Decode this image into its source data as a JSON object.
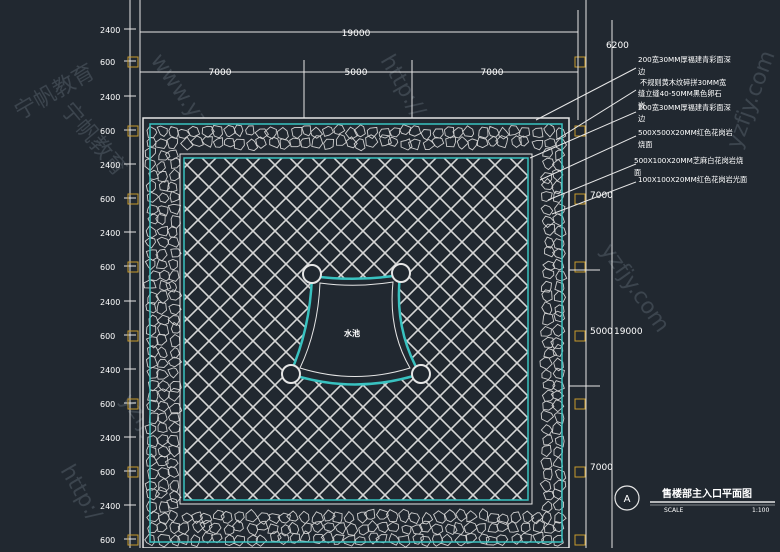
{
  "colors": {
    "background": "#212830",
    "linework": "#e6e6e6",
    "border_cyan": "#39c2c0",
    "dim_text": "#ffffff",
    "pillar": "#c89a2b",
    "watermark": "#6f7a86"
  },
  "left_dims": [
    "2400",
    "600",
    "2400",
    "600",
    "2400",
    "600",
    "2400",
    "600",
    "2400",
    "600",
    "2400",
    "600",
    "2400",
    "600",
    "2400",
    "600"
  ],
  "top_dims": {
    "overall": "19000",
    "left": "7000",
    "middle": "5000",
    "right": "7000"
  },
  "right_dims": {
    "top": "6200",
    "upper": "7000",
    "middle": "5000",
    "total": "19000",
    "lower": "7000"
  },
  "callouts": [
    "200宽30MM厚福建青彩面深",
    "边",
    "不规则黄木纹碎拼30MM宽",
    "缝立缝40-50MM黑色卵石",
    "嵌",
    "200宽30MM厚福建青彩面深",
    "边",
    "500X500X20MM红色花岗岩",
    "烧面",
    "500X100X20MM芝麻白花岗岩烧",
    "面",
    "100X100X20MM红色花岗岩光面"
  ],
  "pool_label": "水池",
  "title_block": {
    "symbol": "A",
    "title": "售楼部主入口平面图",
    "scale_label": "SCALE",
    "scale_value": "1:100"
  },
  "watermarks": [
    "www.yzfjy.com",
    "http://",
    "yzfjy.com",
    "宁帆教育",
    "宁帆教育",
    "http:/",
    "yzfjy.com",
    "http:/",
    "宁帆教育",
    "yzfjy.com"
  ]
}
